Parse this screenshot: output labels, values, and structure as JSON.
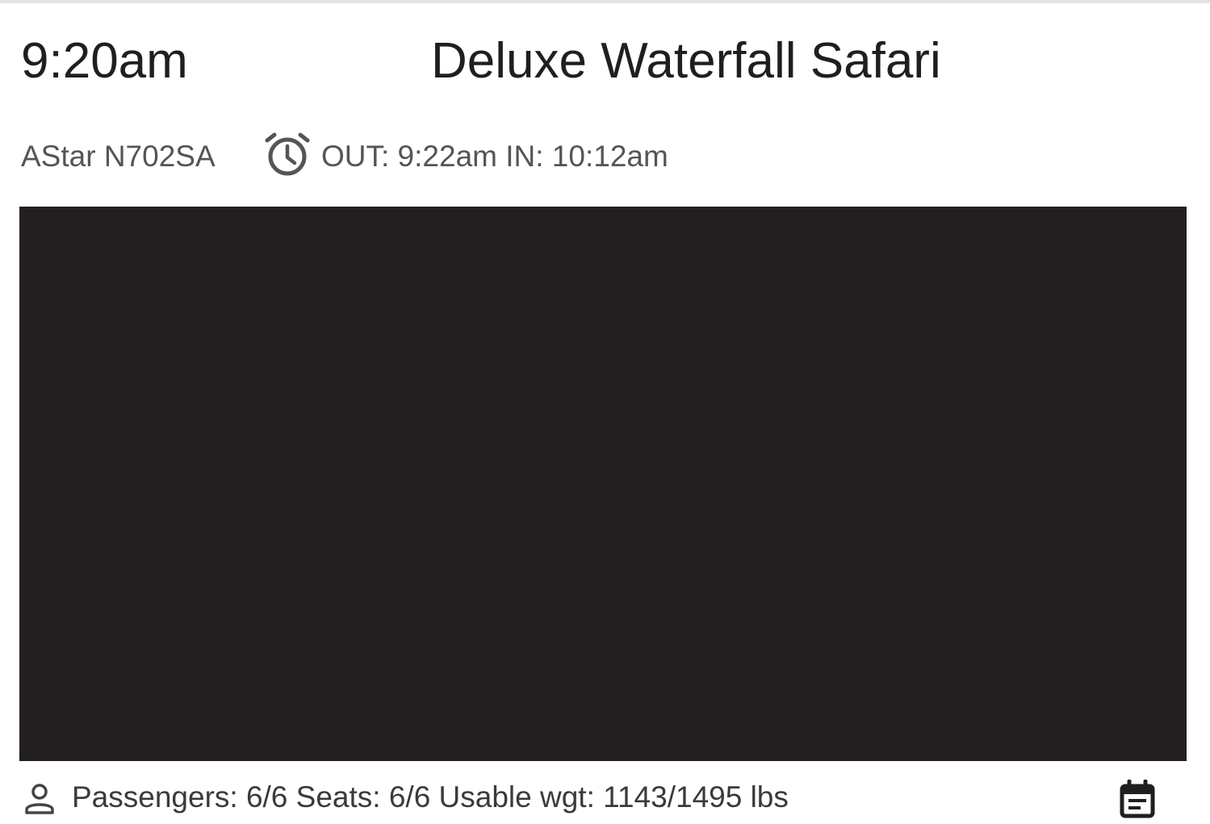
{
  "header": {
    "time": "9:20am",
    "title": "Deluxe Waterfall Safari"
  },
  "flight": {
    "aircraft": "AStar N702SA",
    "times_icon": "alarm-clock-icon",
    "times": "OUT: 9:22am IN: 10:12am"
  },
  "media": {
    "background": "#231f20"
  },
  "footer": {
    "person_icon": "person-outline-icon",
    "stats": "Passengers: 6/6 Seats: 6/6 Usable wgt: 1143/1495 lbs",
    "action_icon": "event-note-icon"
  },
  "colors": {
    "primary_text": "#1f1f1f",
    "secondary_text": "#555555",
    "media_bg": "#231f20"
  }
}
